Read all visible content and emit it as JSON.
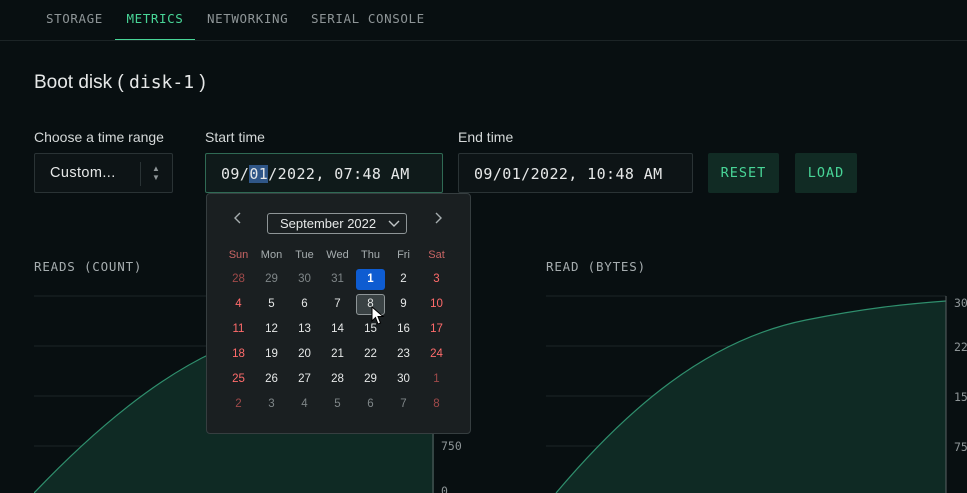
{
  "tabs": [
    {
      "label": "STORAGE",
      "active": false
    },
    {
      "label": "METRICS",
      "active": true
    },
    {
      "label": "NETWORKING",
      "active": false
    },
    {
      "label": "SERIAL CONSOLE",
      "active": false
    }
  ],
  "title": {
    "prefix": "Boot disk ( ",
    "disk": "disk-1",
    "suffix": " )"
  },
  "time_range": {
    "label": "Choose a time range",
    "value": "Custom..."
  },
  "start": {
    "label": "Start time",
    "month": "09",
    "sep1": "/",
    "day": "01",
    "sep2": "/",
    "rest": "2022, 07:48 AM"
  },
  "end": {
    "label": "End time",
    "value": "09/01/2022, 10:48 AM"
  },
  "buttons": {
    "reset": "RESET",
    "load": "LOAD"
  },
  "charts": {
    "reads_label": "READS (COUNT)",
    "read_bytes_label": "READ (BYTES)",
    "left_ticks": [
      "750",
      "0"
    ],
    "right_ticks": [
      "30",
      "22",
      "15",
      "75"
    ]
  },
  "calendar": {
    "month_label": "September 2022",
    "prev_icon": "chevron-left-icon",
    "next_icon": "chevron-right-icon",
    "weekdays": [
      "Sun",
      "Mon",
      "Tue",
      "Wed",
      "Thu",
      "Fri",
      "Sat"
    ],
    "selected_day": "1",
    "hover_day": "8",
    "weeks": [
      [
        {
          "d": "28",
          "out": true
        },
        {
          "d": "29",
          "out": true
        },
        {
          "d": "30",
          "out": true
        },
        {
          "d": "31",
          "out": true
        },
        {
          "d": "1"
        },
        {
          "d": "2"
        },
        {
          "d": "3"
        }
      ],
      [
        {
          "d": "4"
        },
        {
          "d": "5"
        },
        {
          "d": "6"
        },
        {
          "d": "7"
        },
        {
          "d": "8"
        },
        {
          "d": "9"
        },
        {
          "d": "10"
        }
      ],
      [
        {
          "d": "11"
        },
        {
          "d": "12"
        },
        {
          "d": "13"
        },
        {
          "d": "14"
        },
        {
          "d": "15"
        },
        {
          "d": "16"
        },
        {
          "d": "17"
        }
      ],
      [
        {
          "d": "18"
        },
        {
          "d": "19"
        },
        {
          "d": "20"
        },
        {
          "d": "21"
        },
        {
          "d": "22"
        },
        {
          "d": "23"
        },
        {
          "d": "24"
        }
      ],
      [
        {
          "d": "25"
        },
        {
          "d": "26"
        },
        {
          "d": "27"
        },
        {
          "d": "28"
        },
        {
          "d": "29"
        },
        {
          "d": "30"
        },
        {
          "d": "1",
          "out": true
        }
      ],
      [
        {
          "d": "2",
          "out": true
        },
        {
          "d": "3",
          "out": true
        },
        {
          "d": "4",
          "out": true
        },
        {
          "d": "5",
          "out": true
        },
        {
          "d": "6",
          "out": true
        },
        {
          "d": "7",
          "out": true
        },
        {
          "d": "8",
          "out": true
        }
      ]
    ]
  },
  "colors": {
    "accent": "#48d597",
    "selected_day": "#0e5cd1",
    "weekend": "#ff6b6b",
    "chart_fill": "#0f2a24",
    "chart_line": "#2f8f6d"
  }
}
